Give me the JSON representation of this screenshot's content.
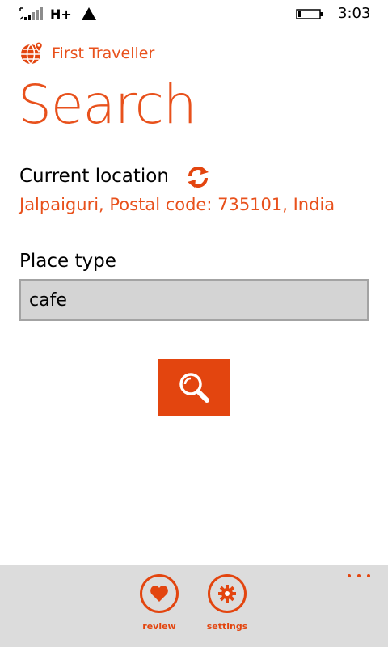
{
  "status_bar": {
    "network_type": "H+",
    "time": "3:03"
  },
  "app": {
    "name": "First Traveller",
    "accent_color": "#e8511c"
  },
  "page": {
    "title": "Search"
  },
  "location": {
    "label": "Current location",
    "value": "Jalpaiguri, Postal code: 735101, India",
    "refresh_icon": "refresh-icon"
  },
  "place_type": {
    "label": "Place type",
    "value": "cafe"
  },
  "search_button": {
    "icon": "search-icon"
  },
  "app_bar": {
    "actions": [
      {
        "label": "review",
        "icon": "heart-icon"
      },
      {
        "label": "settings",
        "icon": "gear-icon"
      }
    ],
    "more_icon": "ellipsis-icon"
  }
}
